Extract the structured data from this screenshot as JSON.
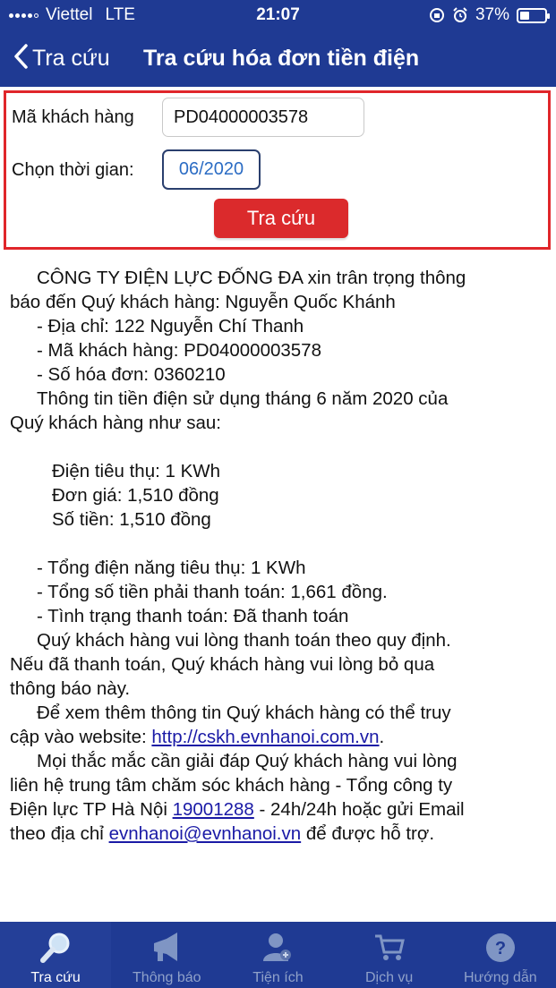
{
  "status_bar": {
    "carrier": "Viettel",
    "network": "LTE",
    "time": "21:07",
    "battery": "37%",
    "battery_level": 0.37
  },
  "nav": {
    "back_label": "Tra cứu",
    "title": "Tra cứu hóa đơn tiền điện"
  },
  "form": {
    "customer_label": "Mã khách hàng",
    "customer_value": "PD04000003578",
    "period_label": "Chọn thời gian:",
    "period_value": "06/2020",
    "submit_label": "Tra cứu"
  },
  "notice": {
    "intro_1": "CÔNG TY ĐIỆN LỰC ĐỐNG ĐA xin trân trọng thông",
    "intro_2": "báo đến Quý khách hàng: Nguyễn Quốc Khánh",
    "address": "- Địa chỉ: 122 Nguyễn Chí Thanh",
    "customer_code": "- Mã khách hàng: PD04000003578",
    "invoice_no": "- Số hóa đơn: 0360210",
    "usage_intro_1": "Thông tin tiền điện sử dụng tháng 6 năm 2020 của",
    "usage_intro_2": "Quý khách hàng như sau:",
    "consumption": "Điện tiêu thụ: 1 KWh",
    "unit_price": "Đơn giá: 1,510 đồng",
    "amount": "Số tiền: 1,510 đồng",
    "total_consumption": "- Tổng điện năng tiêu thụ: 1 KWh",
    "total_payable": "- Tổng số tiền phải thanh toán: 1,661 đồng.",
    "payment_status": "- Tình trạng thanh toán: Đã thanh toán",
    "pay_note_1": "Quý khách hàng vui lòng thanh toán theo quy định.",
    "pay_note_2": "Nếu đã thanh toán, Quý khách hàng vui lòng bỏ qua",
    "pay_note_3": "thông báo này.",
    "web_note_1": "Để xem thêm thông tin Quý khách hàng có thể truy",
    "web_note_2_prefix": "cập vào website: ",
    "website": "http://cskh.evnhanoi.com.vn",
    "web_note_2_suffix": ".",
    "contact_1": "Mọi thắc mắc cần giải đáp Quý khách hàng vui lòng",
    "contact_2": "liên hệ trung tâm chăm sóc khách hàng - Tổng công ty",
    "contact_3_prefix": "Điện lực TP Hà Nội ",
    "hotline": "19001288",
    "contact_3_suffix": " - 24h/24h hoặc gửi Email",
    "contact_4_prefix": "theo địa chỉ ",
    "email": "evnhanoi@evnhanoi.vn",
    "contact_4_suffix": " để được hỗ trợ."
  },
  "tabs": [
    {
      "label": "Tra cứu",
      "icon": "magnifier-icon",
      "active": true
    },
    {
      "label": "Thông báo",
      "icon": "megaphone-icon",
      "active": false
    },
    {
      "label": "Tiện ích",
      "icon": "user-plus-icon",
      "active": false
    },
    {
      "label": "Dịch vụ",
      "icon": "shopping-cart-icon",
      "active": false
    },
    {
      "label": "Hướng dẫn",
      "icon": "help-icon",
      "active": false
    }
  ],
  "colors": {
    "header_bg": "#1f3a93",
    "highlight_border": "#e0262a",
    "button_bg": "#db2a2c",
    "link": "#1a1aa6",
    "date_text": "#2b6cc4"
  }
}
